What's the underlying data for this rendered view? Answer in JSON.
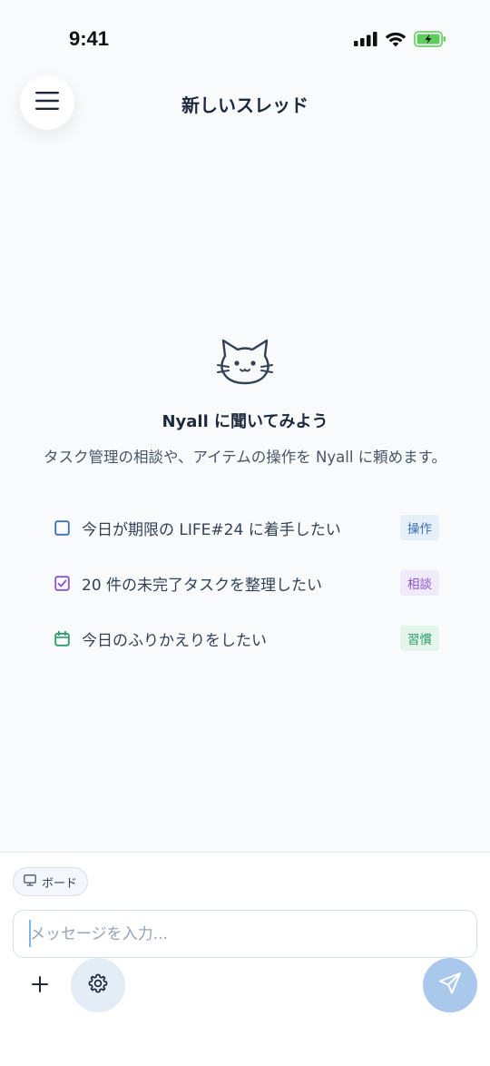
{
  "status_bar": {
    "time": "9:41"
  },
  "header": {
    "title": "新しいスレッド"
  },
  "empty_state": {
    "title": "Nyall に聞いてみよう",
    "description": "タスク管理の相談や、アイテムの操作を Nyall に頼めます。"
  },
  "suggestions": [
    {
      "text": "今日が期限の LIFE#24 に着手したい",
      "badge": "操作",
      "icon": "square-icon",
      "badge_color": "#3B6FB6",
      "badge_bg": "#E6EEF8"
    },
    {
      "text": "20 件の未完了タスクを整理したい",
      "badge": "相談",
      "icon": "checkbox-icon",
      "badge_color": "#8A55C9",
      "badge_bg": "#F1EAFB"
    },
    {
      "text": "今日のふりかえりをしたい",
      "badge": "習慣",
      "icon": "calendar-icon",
      "badge_color": "#2E9A6A",
      "badge_bg": "#E4F5EC"
    }
  ],
  "composer": {
    "board_chip": "ボード",
    "placeholder": "メッセージを入力..."
  },
  "colors": {
    "accent": "#A9C8EC",
    "title": "#1E293B",
    "muted": "#475569"
  }
}
